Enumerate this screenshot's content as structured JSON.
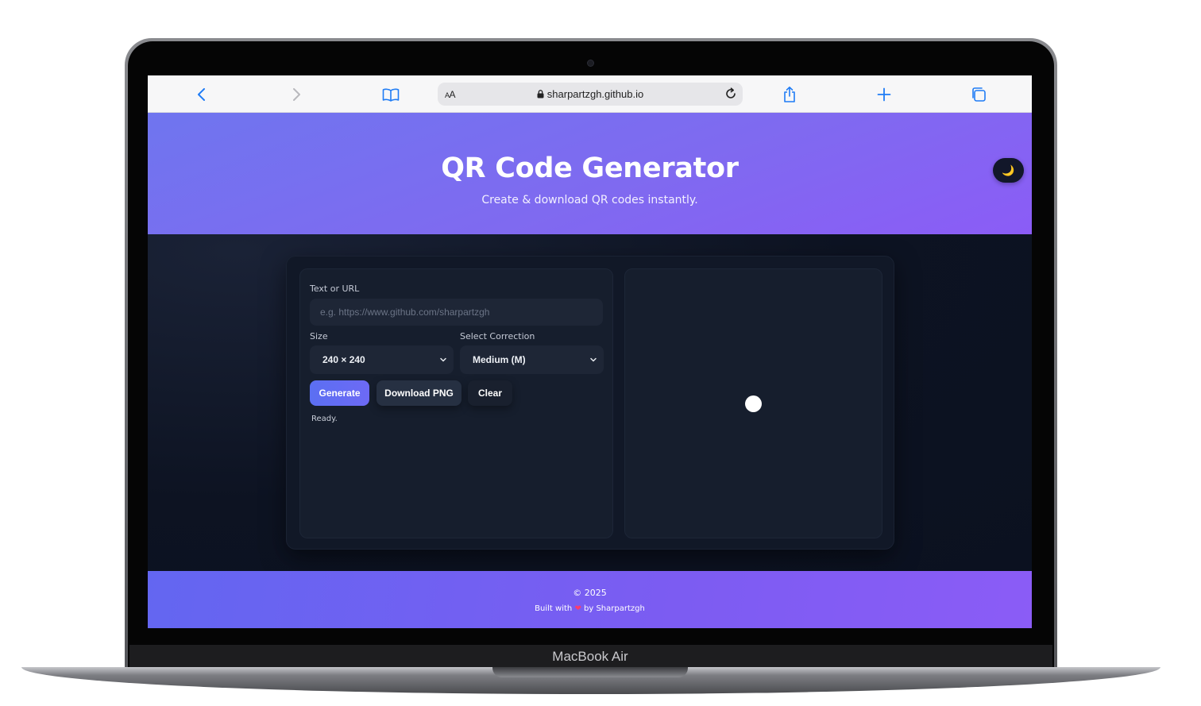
{
  "device": {
    "label": "MacBook Air"
  },
  "browser": {
    "url": "sharpartzgh.github.io",
    "text_size_label": "AA",
    "icons": [
      "back-icon",
      "forward-icon",
      "bookmarks-icon",
      "lock-icon",
      "reload-icon",
      "share-icon",
      "new-tab-icon",
      "tabs-icon"
    ]
  },
  "header": {
    "title": "QR Code Generator",
    "subtitle": "Create & download QR codes instantly.",
    "theme_toggle_icon": "🌙"
  },
  "form": {
    "text_label": "Text or URL",
    "text_value": "",
    "text_placeholder": "e.g. https://www.github.com/sharpartzgh",
    "size_label": "Size",
    "size_value": "240 × 240",
    "correction_label": "Select Correction",
    "correction_value": "Medium (M)",
    "generate_label": "Generate",
    "download_label": "Download PNG",
    "clear_label": "Clear",
    "status": "Ready."
  },
  "footer": {
    "copyright": "© 2025",
    "built_prefix": "Built with",
    "heart": "❤",
    "built_suffix": "by Sharpartzgh"
  },
  "colors": {
    "accent": "#6366f1",
    "accent_purple": "#8b5cf6",
    "background": "#0f1524",
    "card": "#111827",
    "panel": "#161e2d",
    "input": "#1e2636"
  }
}
